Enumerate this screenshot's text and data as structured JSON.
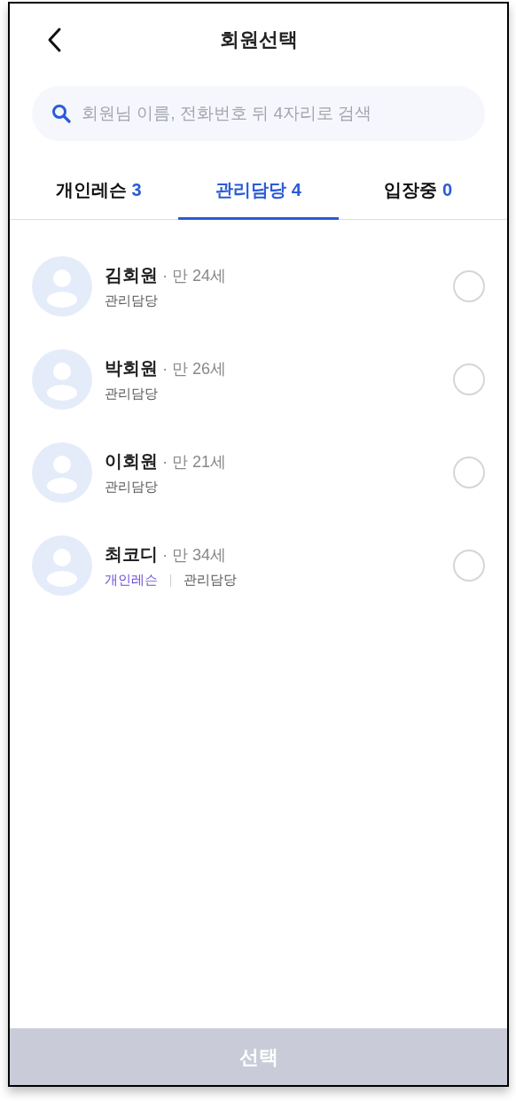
{
  "header": {
    "title": "회원선택"
  },
  "search": {
    "placeholder": "회원님 이름, 전화번호 뒤 4자리로 검색"
  },
  "tabs": [
    {
      "label": "개인레슨",
      "count": "3",
      "selected": false
    },
    {
      "label": "관리담당",
      "count": "4",
      "selected": true
    },
    {
      "label": "입장중",
      "count": "0",
      "selected": false
    }
  ],
  "members": [
    {
      "name": "김회원",
      "age": "· 만 24세",
      "selected": false,
      "tags": [
        {
          "kind": "manage",
          "label": "관리담당"
        }
      ]
    },
    {
      "name": "박회원",
      "age": "· 만 26세",
      "selected": false,
      "tags": [
        {
          "kind": "manage",
          "label": "관리담당"
        }
      ]
    },
    {
      "name": "이회원",
      "age": "· 만 21세",
      "selected": false,
      "tags": [
        {
          "kind": "manage",
          "label": "관리담당"
        }
      ]
    },
    {
      "name": "최코디",
      "age": "· 만 34세",
      "selected": false,
      "tags": [
        {
          "kind": "lesson",
          "label": "개인레슨"
        },
        {
          "kind": "manage",
          "label": "관리담당"
        }
      ]
    }
  ],
  "submit": {
    "label": "선택",
    "disabled": true
  }
}
